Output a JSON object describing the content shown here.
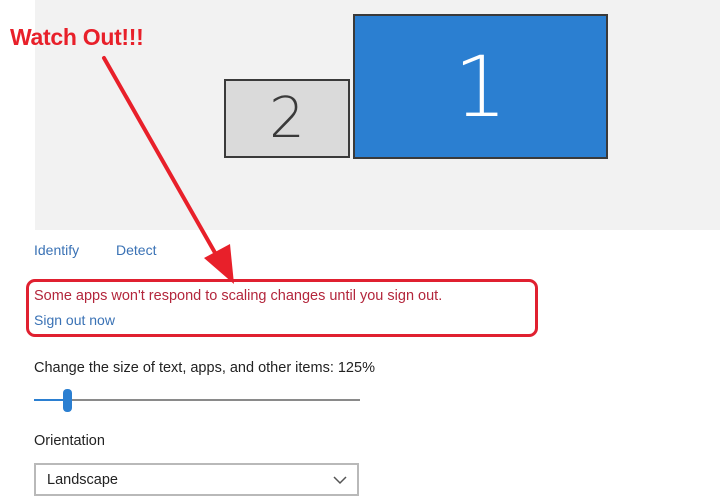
{
  "annotation": {
    "label": "Watch Out!!!",
    "color": "#e8202a"
  },
  "displays": {
    "monitor_1_label": "1",
    "monitor_2_label": "2",
    "identify_label": "Identify",
    "detect_label": "Detect",
    "selected_color": "#2b7fd1"
  },
  "warning": {
    "message": "Some apps won't respond to scaling changes until you sign out.",
    "sign_out_label": "Sign out now"
  },
  "scaling": {
    "label": "Change the size of text, apps, and other items: 125%",
    "slider_value_percent": 125,
    "slider_min_percent": 100,
    "slider_max_percent": 350
  },
  "orientation": {
    "label": "Orientation",
    "selected": "Landscape"
  }
}
